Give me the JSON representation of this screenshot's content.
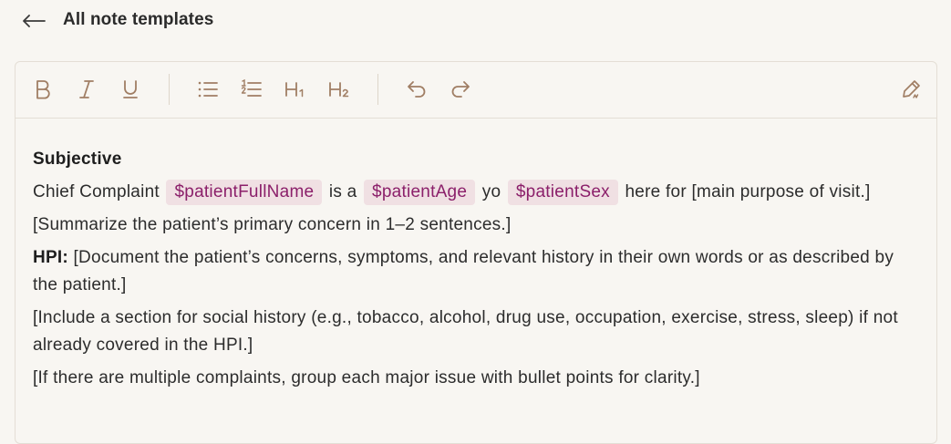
{
  "header": {
    "back_label": "All note templates",
    "back_icon": "arrow-left-icon"
  },
  "toolbar": {
    "buttons": [
      {
        "icon": "bold-icon",
        "glyph": "B"
      },
      {
        "icon": "italic-icon",
        "glyph": "I"
      },
      {
        "icon": "underline-icon",
        "glyph": "U"
      },
      {
        "icon": "bullet-list-icon"
      },
      {
        "icon": "numbered-list-icon"
      },
      {
        "icon": "heading-1-icon",
        "glyph": "H1"
      },
      {
        "icon": "heading-2-icon",
        "glyph": "H2"
      },
      {
        "icon": "undo-icon"
      },
      {
        "icon": "redo-icon"
      },
      {
        "icon": "edit-pen-icon"
      }
    ],
    "icon_color": "#a07e64"
  },
  "document": {
    "heading": "Subjective",
    "p1": {
      "prefix": "Chief Complaint",
      "var1": "$patientFullName",
      "mid1": "is a",
      "var2": "$patientAge",
      "mid2": "yo",
      "var3": "$patientSex",
      "suffix": "here for [main purpose of visit.]"
    },
    "p2": "[Summarize the patient’s primary concern in 1–2 sentences.]",
    "p3": {
      "label": "HPI:",
      "text": "[Document the patient’s concerns, symptoms, and relevant history in their own words or as described by the patient.]"
    },
    "p4": "[Include a section for social history (e.g., tobacco, alcohol, drug use, occupation, exercise, stress, sleep) if not already covered in the HPI.]",
    "p5": "[If there are multiple complaints, group each major issue with bullet points for clarity.]"
  },
  "colors": {
    "background": "#f8f6f2",
    "variable_bg": "#f0e0e3",
    "variable_text": "#8b1f6a",
    "border": "#e4ded5"
  }
}
